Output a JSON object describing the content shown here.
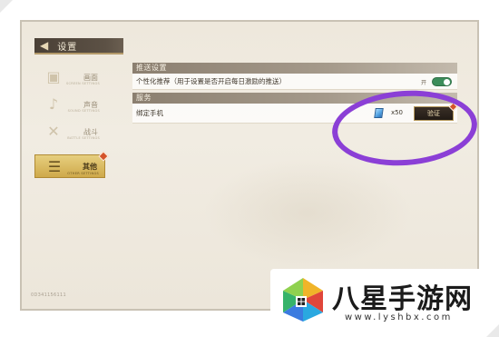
{
  "title": "设置",
  "nav": [
    {
      "label": "画面",
      "sub": "SCREEN SETTINGS",
      "icon": "picture-icon",
      "active": false
    },
    {
      "label": "声音",
      "sub": "SOUND SETTINGS",
      "icon": "sound-icon",
      "active": false
    },
    {
      "label": "战斗",
      "sub": "BATTLE SETTINGS",
      "icon": "battle-icon",
      "active": false
    },
    {
      "label": "其他",
      "sub": "OTHER SETTINGS",
      "icon": "list-icon",
      "active": true
    }
  ],
  "sections": {
    "push": {
      "header": "推送设置",
      "personalized": {
        "label": "个性化推荐（用于设置是否开启每日激励的推送）",
        "toggle_text": "开",
        "enabled": true
      }
    },
    "service": {
      "header": "服务",
      "bind_phone": {
        "label": "绑定手机",
        "reward_icon": "gem-icon",
        "reward_count": "x50",
        "button_label": "验证"
      }
    }
  },
  "footer_id": "0D341156111",
  "colors": {
    "annotation": "#8b3fd6",
    "toggle_on": "#3c8d5a",
    "active_tab": "#cfa94a",
    "header": "#8b7f70"
  },
  "watermark": {
    "name": "八星手游网",
    "url": "www.lyshbx.com"
  }
}
